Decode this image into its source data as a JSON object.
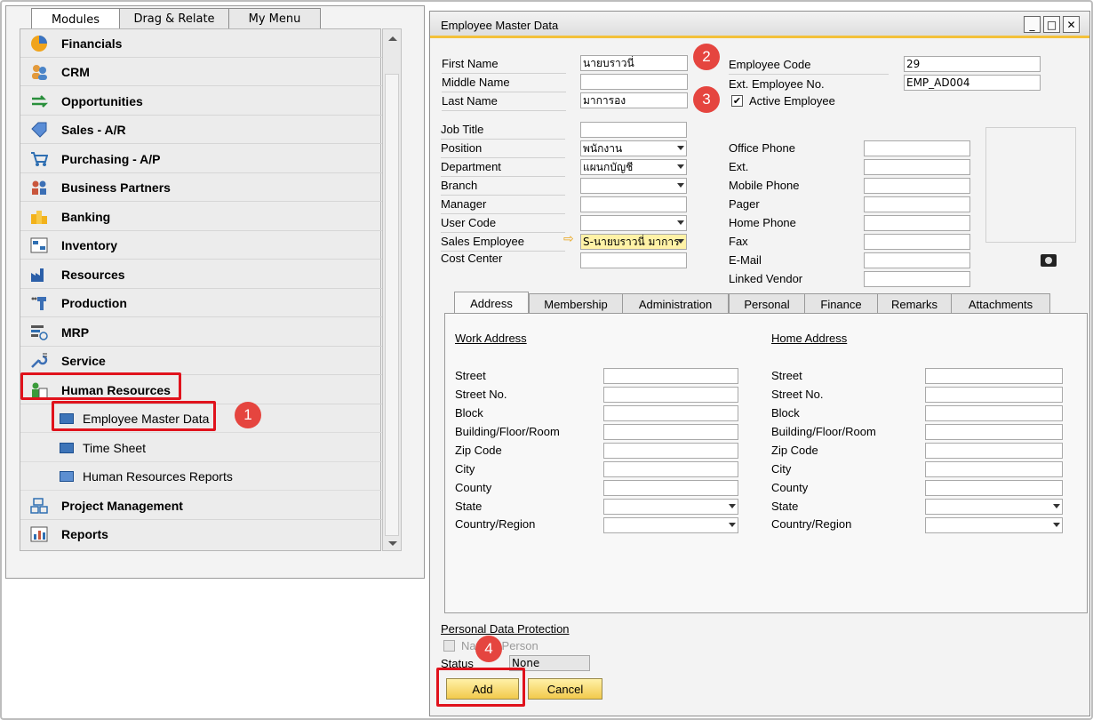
{
  "left_panel": {
    "tabs": [
      "Modules",
      "Drag & Relate",
      "My Menu"
    ],
    "modules": [
      {
        "label": "Financials",
        "icon": "pie-chart-icon"
      },
      {
        "label": "CRM",
        "icon": "people-icon"
      },
      {
        "label": "Opportunities",
        "icon": "arrows-icon"
      },
      {
        "label": "Sales - A/R",
        "icon": "sales-tag-icon"
      },
      {
        "label": "Purchasing - A/P",
        "icon": "shopping-cart-icon"
      },
      {
        "label": "Business Partners",
        "icon": "partners-icon"
      },
      {
        "label": "Banking",
        "icon": "coins-icon"
      },
      {
        "label": "Inventory",
        "icon": "inventory-icon"
      },
      {
        "label": "Resources",
        "icon": "factory-icon"
      },
      {
        "label": "Production",
        "icon": "production-icon"
      },
      {
        "label": "MRP",
        "icon": "mrp-icon"
      },
      {
        "label": "Service",
        "icon": "wrench-icon"
      },
      {
        "label": "Human Resources",
        "icon": "human-resources-icon"
      }
    ],
    "hr_submenu": [
      "Employee Master Data",
      "Time Sheet",
      "Human Resources Reports"
    ],
    "modules_after": [
      {
        "label": "Project Management",
        "icon": "project-icon"
      },
      {
        "label": "Reports",
        "icon": "reports-icon"
      }
    ]
  },
  "window": {
    "title": "Employee Master Data",
    "header_fields": {
      "first_name_label": "First Name",
      "first_name_value": "นายบราวนี่",
      "middle_name_label": "Middle Name",
      "middle_name_value": "",
      "last_name_label": "Last Name",
      "last_name_value": "มาการอง",
      "employee_code_label": "Employee Code",
      "employee_code_value": "29",
      "ext_employee_no_label": "Ext. Employee No.",
      "ext_employee_no_value": "EMP_AD004",
      "active_employee_label": "Active Employee",
      "active_employee_checked": true
    },
    "left_fields": [
      {
        "label": "Job Title",
        "value": "",
        "type": "text"
      },
      {
        "label": "Position",
        "value": "พนักงาน",
        "type": "select"
      },
      {
        "label": "Department",
        "value": "แผนกบัญชี",
        "type": "select"
      },
      {
        "label": "Branch",
        "value": "",
        "type": "select"
      },
      {
        "label": "Manager",
        "value": "",
        "type": "text"
      },
      {
        "label": "User Code",
        "value": "",
        "type": "select"
      },
      {
        "label": "Sales Employee",
        "value": "S-นายบราวนี่ มาการ",
        "type": "select"
      },
      {
        "label": "Cost Center",
        "value": "",
        "type": "text"
      }
    ],
    "right_fields": [
      {
        "label": "Office Phone",
        "value": ""
      },
      {
        "label": "Ext.",
        "value": ""
      },
      {
        "label": "Mobile Phone",
        "value": ""
      },
      {
        "label": "Pager",
        "value": ""
      },
      {
        "label": "Home Phone",
        "value": ""
      },
      {
        "label": "Fax",
        "value": ""
      },
      {
        "label": "E-Mail",
        "value": ""
      },
      {
        "label": "Linked Vendor",
        "value": ""
      }
    ],
    "tabs": [
      "Address",
      "Membership",
      "Administration",
      "Personal",
      "Finance",
      "Remarks",
      "Attachments"
    ],
    "address": {
      "work_title": "Work Address",
      "home_title": "Home Address",
      "fields": [
        "Street",
        "Street No.",
        "Block",
        "Building/Floor/Room",
        "Zip Code",
        "City",
        "County",
        "State",
        "Country/Region"
      ]
    },
    "pdp": {
      "title": "Personal Data Protection",
      "natural_person_label": "Natural Person",
      "status_label": "Status",
      "status_value": "None"
    },
    "buttons": {
      "add": "Add",
      "cancel": "Cancel"
    }
  },
  "annotations": {
    "b1": "1",
    "b2": "2",
    "b3": "3",
    "b4": "4"
  },
  "colors": {
    "highlight_red": "#e0121c",
    "badge_red": "#e5453f",
    "title_accent": "#f3c13a",
    "button_yellow": "#f2c94c"
  }
}
